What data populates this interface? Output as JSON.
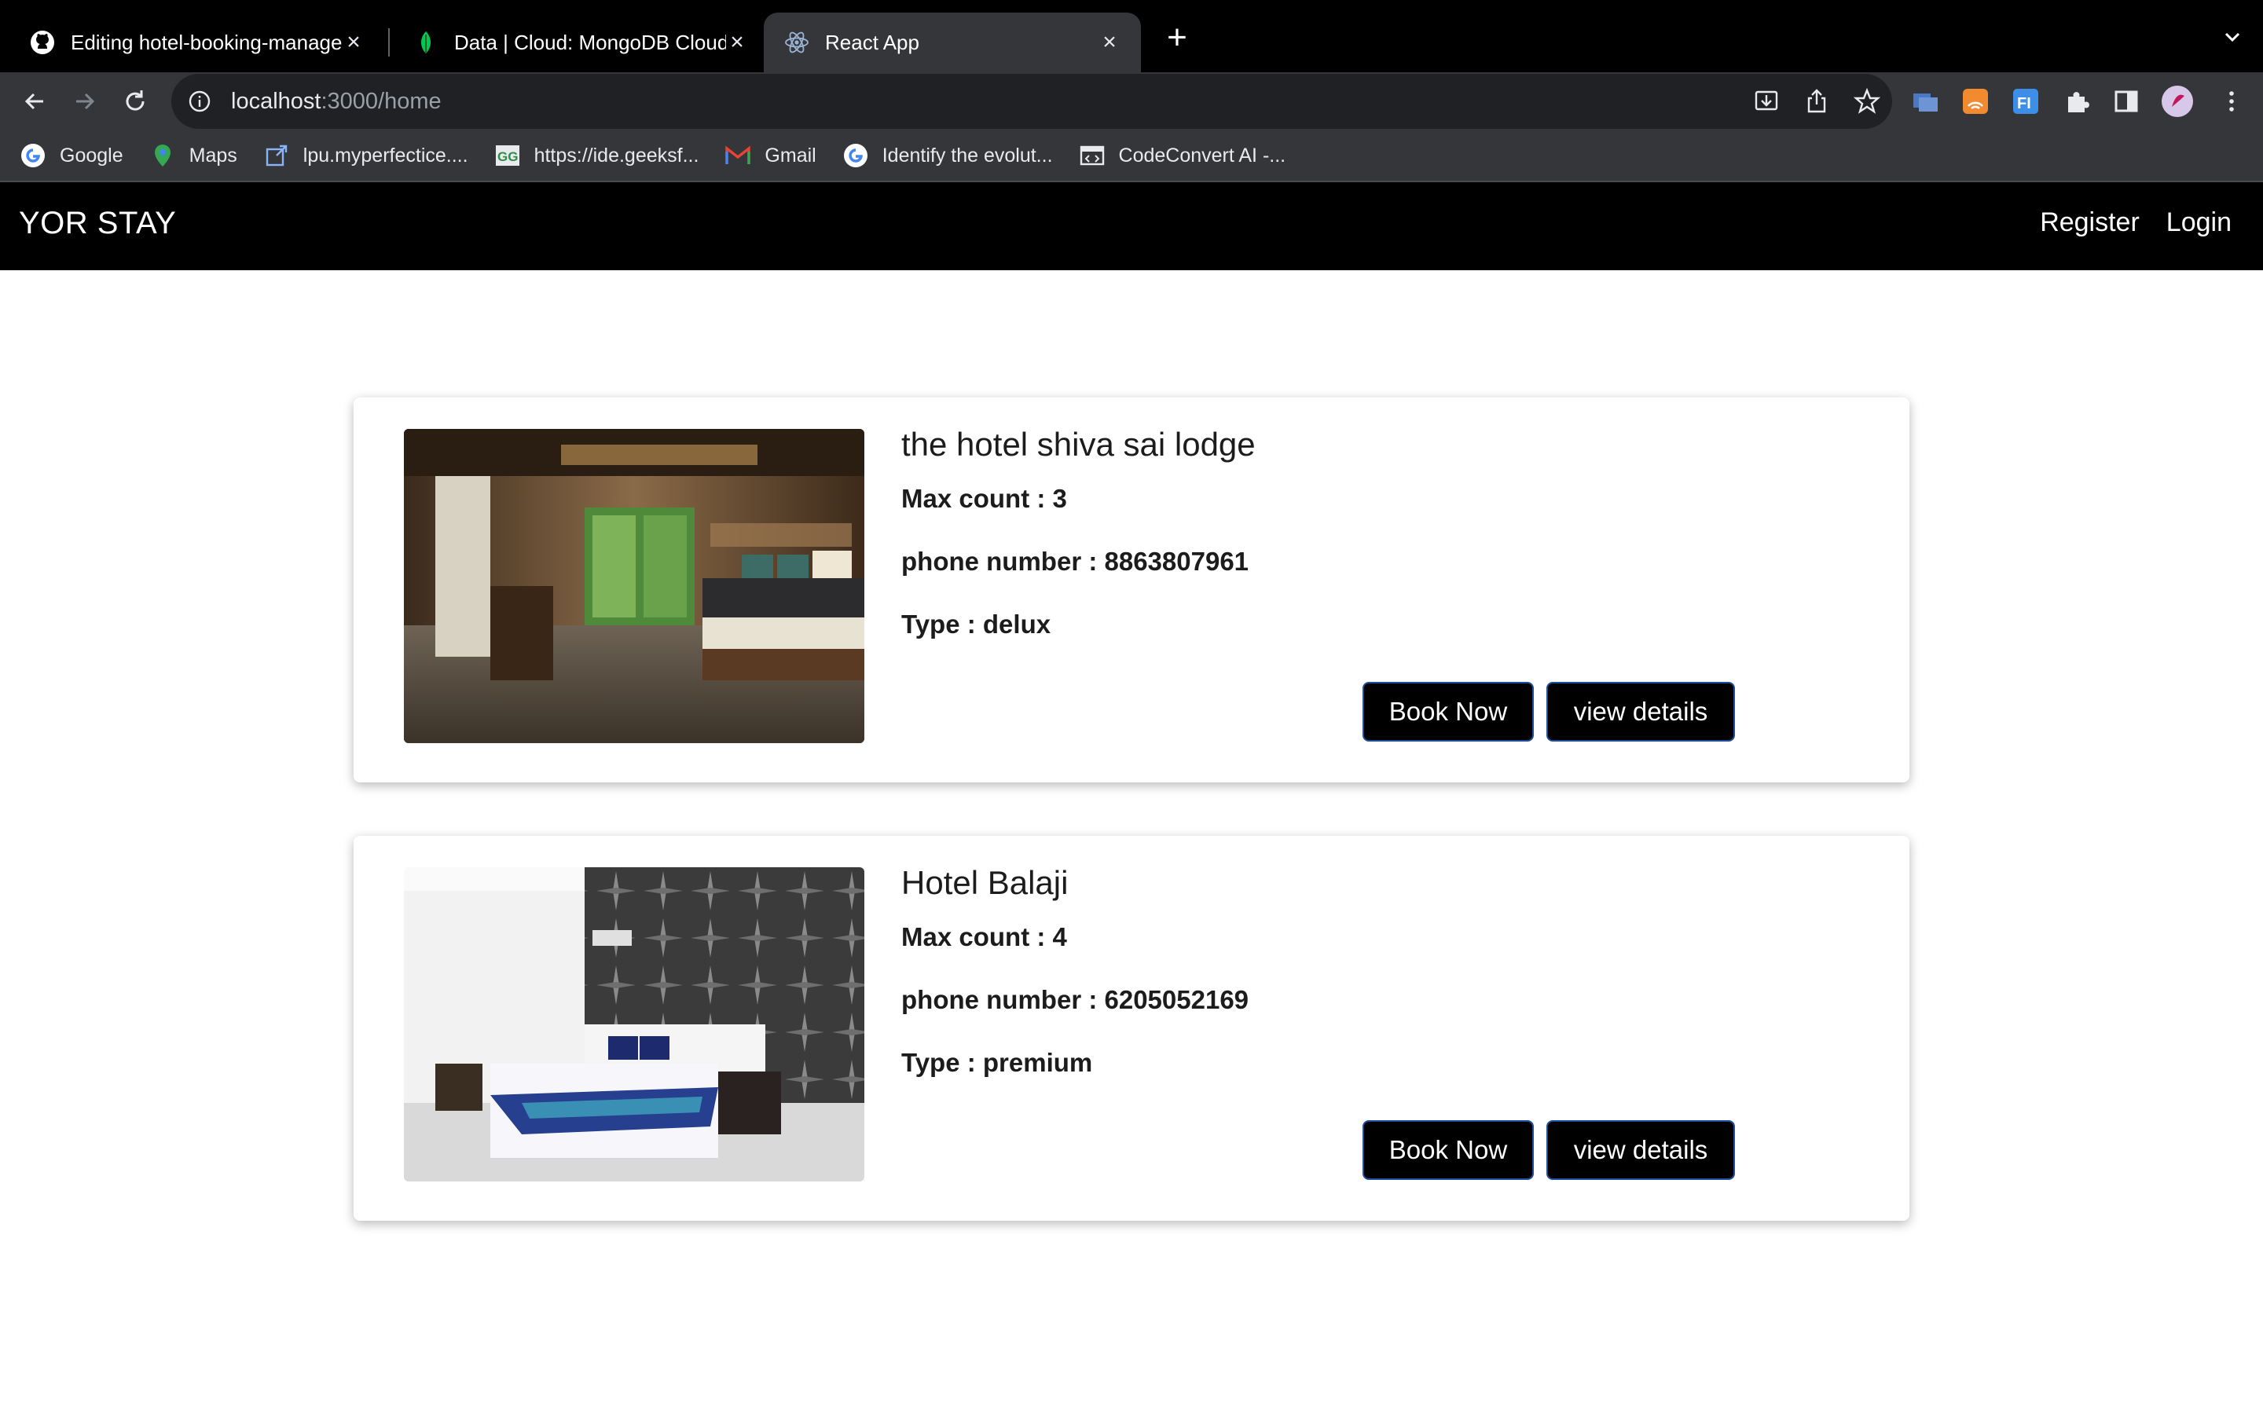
{
  "browser": {
    "tabs": [
      {
        "title": "Editing hotel-booking-managem",
        "icon": "github-icon",
        "active": false
      },
      {
        "title": "Data | Cloud: MongoDB Cloud",
        "icon": "mongodb-leaf-icon",
        "active": false
      },
      {
        "title": "React App",
        "icon": "react-icon",
        "active": true
      }
    ],
    "url_host": "localhost",
    "url_path": ":3000/home",
    "bookmarks": [
      {
        "label": "Google",
        "icon": "google-icon"
      },
      {
        "label": "Maps",
        "icon": "maps-icon"
      },
      {
        "label": "lpu.myperfectice....",
        "icon": "external-link-icon"
      },
      {
        "label": "https://ide.geeksf...",
        "icon": "geeksforgeeks-icon"
      },
      {
        "label": "Gmail",
        "icon": "gmail-icon"
      },
      {
        "label": "Identify the evolut...",
        "icon": "google-icon"
      },
      {
        "label": "CodeConvert AI -...",
        "icon": "codeconvert-icon"
      }
    ]
  },
  "navbar": {
    "brand": "YOR STAY",
    "links": [
      "Register",
      "Login"
    ]
  },
  "rooms": [
    {
      "name": "the hotel shiva sai lodge",
      "max_count": "Max count : 3",
      "phone": "phone number : 8863807961",
      "type": "Type : delux",
      "book_label": "Book Now",
      "details_label": "view details"
    },
    {
      "name": "Hotel Balaji",
      "max_count": "Max count : 4",
      "phone": "phone number : 6205052169",
      "type": "Type : premium",
      "book_label": "Book Now",
      "details_label": "view details"
    }
  ],
  "colors": {
    "navbar_bg": "#000000",
    "button_bg": "#000000",
    "button_border": "#1e4f9c"
  }
}
